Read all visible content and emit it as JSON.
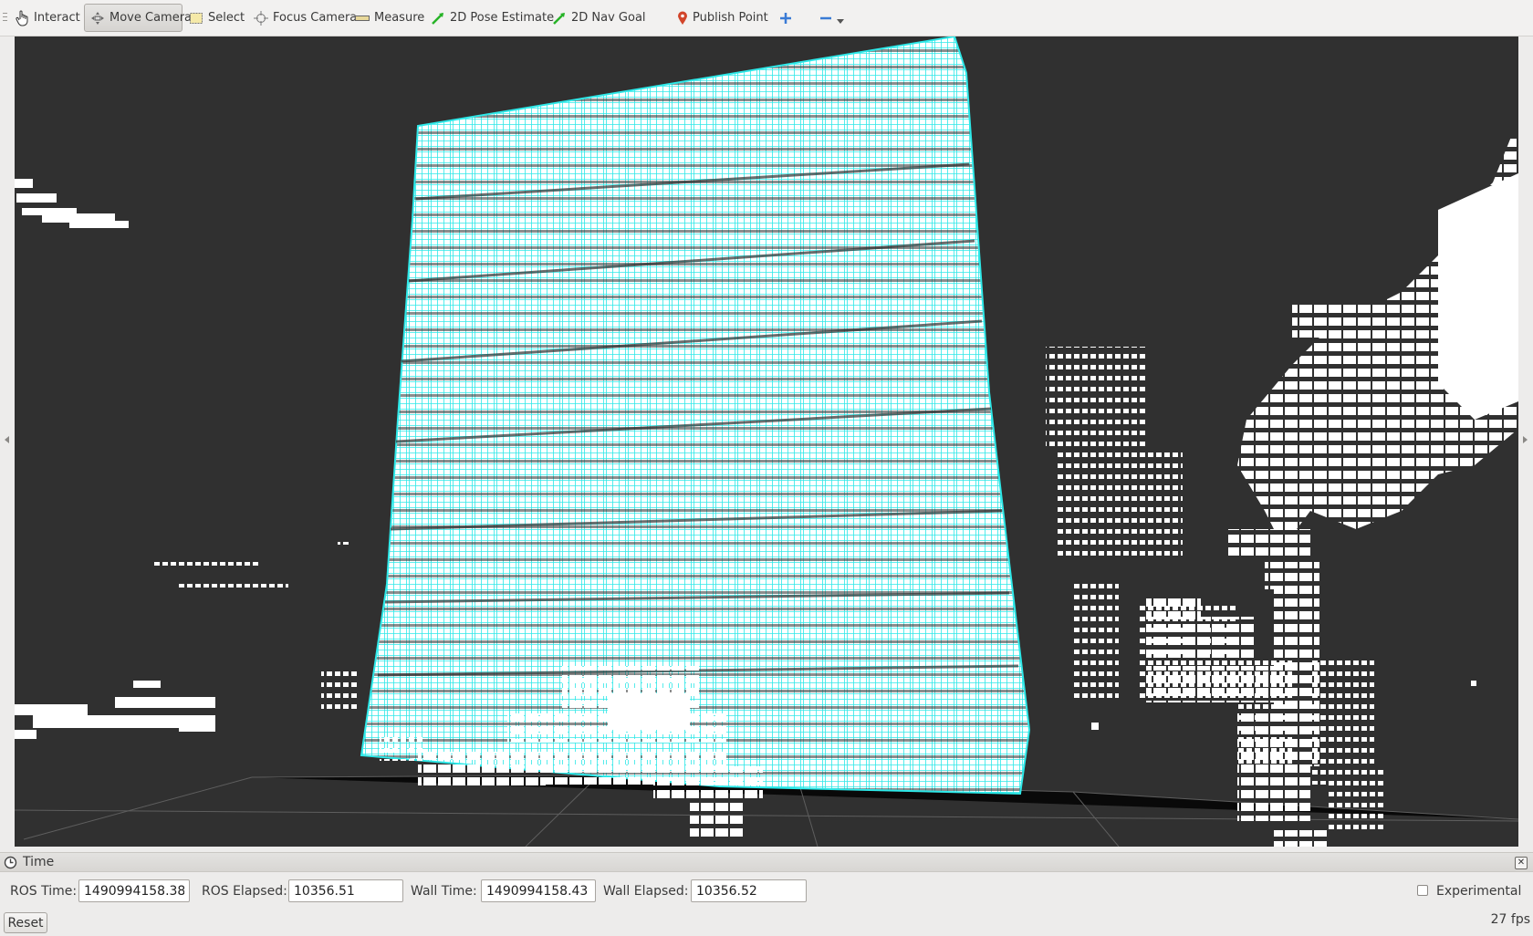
{
  "toolbar": {
    "tools": [
      {
        "label": "Interact",
        "icon": "hand-pointer-icon"
      },
      {
        "label": "Move Camera",
        "icon": "move-camera-icon",
        "active": true
      },
      {
        "label": "Select",
        "icon": "select-box-icon"
      },
      {
        "label": "Focus Camera",
        "icon": "crosshair-icon"
      },
      {
        "label": "Measure",
        "icon": "ruler-icon"
      },
      {
        "label": "2D Pose Estimate",
        "icon": "green-arrow-icon"
      },
      {
        "label": "2D Nav Goal",
        "icon": "green-arrow-icon"
      },
      {
        "label": "Publish Point",
        "icon": "map-pin-icon"
      }
    ],
    "add_icon": "plus-icon",
    "remove_icon": "minus-icon"
  },
  "viewport": {
    "background": "#303030",
    "point_colors": {
      "highlighted": "#2de8e8",
      "normal": "#ffffff"
    }
  },
  "time_panel": {
    "title": "Time",
    "ros_time_label": "ROS Time:",
    "ros_time_value": "1490994158.38",
    "ros_elapsed_label": "ROS Elapsed:",
    "ros_elapsed_value": "10356.51",
    "wall_time_label": "Wall Time:",
    "wall_time_value": "1490994158.43",
    "wall_elapsed_label": "Wall Elapsed:",
    "wall_elapsed_value": "10356.52",
    "experimental_label": "Experimental",
    "experimental_checked": false
  },
  "status": {
    "reset_label": "Reset",
    "fps": "27 fps"
  }
}
